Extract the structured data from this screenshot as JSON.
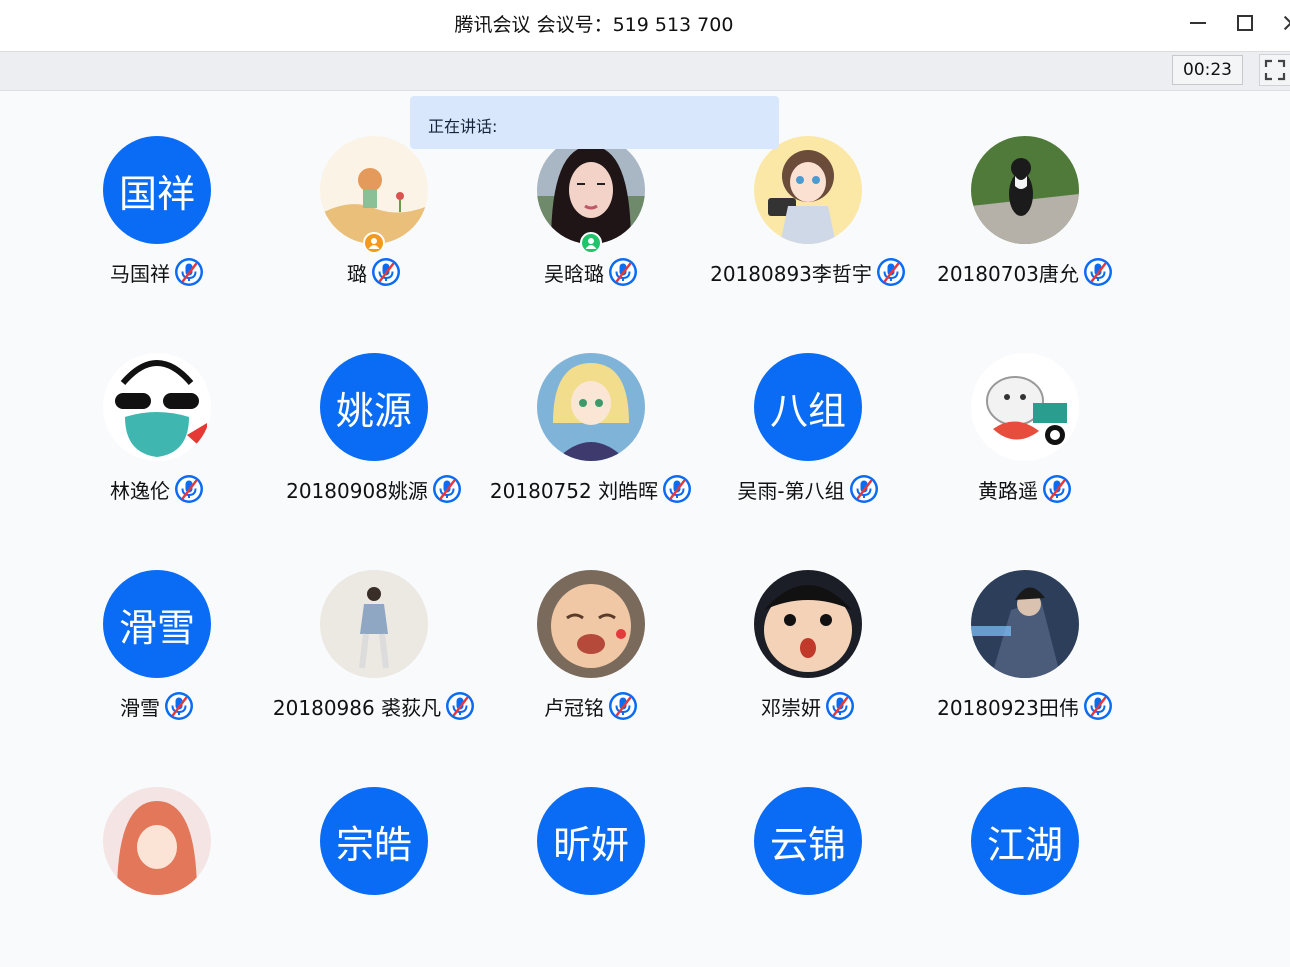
{
  "window": {
    "title": "腾讯会议 会议号：519 513 700"
  },
  "toolbar": {
    "timer": "00:23"
  },
  "speaking": {
    "label": "正在讲话:"
  },
  "colors": {
    "accent": "#0a6cf5",
    "speaking_bg": "#d9e7fd",
    "status_orange": "#f39a1a",
    "status_green": "#1fc46b"
  },
  "participants": [
    {
      "name": "马国祥",
      "avatar_text": "国祥",
      "avatar_type": "text",
      "mic": "muted"
    },
    {
      "name": "璐",
      "avatar_type": "photo",
      "avatar_desc": "illustration-boy-desert",
      "status_badge": "orange-user",
      "mic": "muted"
    },
    {
      "name": "吴晗璐",
      "avatar_type": "photo",
      "avatar_desc": "selfie-girl",
      "status_badge": "green-user",
      "mic": "muted"
    },
    {
      "name": "20180893李哲宇",
      "avatar_type": "photo",
      "avatar_desc": "anime-girl-camera",
      "mic": "muted"
    },
    {
      "name": "20180703唐允",
      "avatar_type": "photo",
      "avatar_desc": "cat-on-grass",
      "mic": "muted"
    },
    {
      "name": "林逸伦",
      "avatar_type": "photo",
      "avatar_desc": "cartoon-mask-sunglasses",
      "mic": "muted"
    },
    {
      "name": "20180908姚源",
      "avatar_text": "姚源",
      "avatar_type": "text",
      "mic": "muted"
    },
    {
      "name": "20180752 刘皓晖",
      "avatar_type": "photo",
      "avatar_desc": "anime-blonde-knight",
      "mic": "muted"
    },
    {
      "name": "吴雨-第八组",
      "avatar_text": "八组",
      "avatar_type": "text",
      "mic": "muted"
    },
    {
      "name": "黄路遥",
      "avatar_type": "photo",
      "avatar_desc": "cat-panda-sticker",
      "mic": "muted"
    },
    {
      "name": "滑雪",
      "avatar_text": "滑雪",
      "avatar_type": "text",
      "mic": "muted"
    },
    {
      "name": "20180986 裘荻凡",
      "avatar_type": "photo",
      "avatar_desc": "person-standing-photo",
      "mic": "muted"
    },
    {
      "name": "卢冠铭",
      "avatar_type": "photo",
      "avatar_desc": "crying-baby-meme",
      "mic": "muted"
    },
    {
      "name": "邓崇妍",
      "avatar_type": "photo",
      "avatar_desc": "surprised-kid-meme",
      "mic": "muted"
    },
    {
      "name": "20180923田伟",
      "avatar_type": "photo",
      "avatar_desc": "game-character-art",
      "mic": "muted"
    },
    {
      "name": "",
      "avatar_type": "photo",
      "avatar_desc": "anime-redhair",
      "mic": "muted"
    },
    {
      "name": "",
      "avatar_text": "宗皓",
      "avatar_type": "text",
      "mic": "muted"
    },
    {
      "name": "",
      "avatar_text": "昕妍",
      "avatar_type": "text",
      "mic": "muted"
    },
    {
      "name": "",
      "avatar_text": "云锦",
      "avatar_type": "text",
      "mic": "muted"
    },
    {
      "name": "",
      "avatar_text": "江湖",
      "avatar_type": "text",
      "mic": "muted"
    }
  ]
}
